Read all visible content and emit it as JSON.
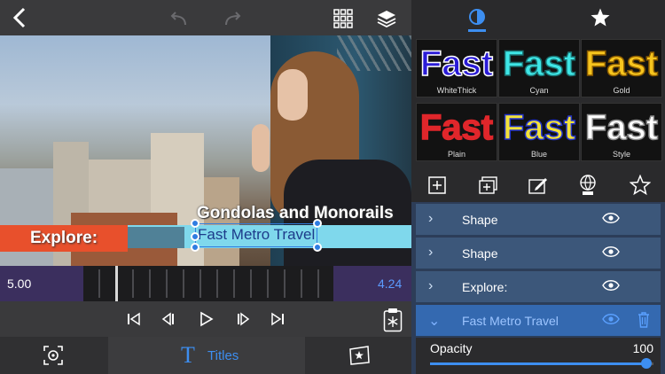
{
  "styles": [
    {
      "word": "Fast",
      "label": "WhiteThick",
      "fill": "#2a1bd6",
      "stroke": "#ffffff"
    },
    {
      "word": "Fast",
      "label": "Cyan",
      "fill": "#3ee6e6",
      "stroke": "#1a6f6f"
    },
    {
      "word": "Fast",
      "label": "Gold",
      "fill": "#f7c51e",
      "stroke": "#8a5b00"
    },
    {
      "word": "Fast",
      "label": "Plain",
      "fill": "#e0262b",
      "stroke": "#e0262b"
    },
    {
      "word": "Fast",
      "label": "Blue",
      "fill": "#f3e23a",
      "stroke": "#2233cc"
    },
    {
      "word": "Fast",
      "label": "Style",
      "fill": "#ffffff",
      "stroke": "#888888"
    }
  ],
  "overlay": {
    "heading": "Gondolas and Monorails",
    "subheading": "Fast Metro Travel",
    "tag": "Explore:"
  },
  "timeline": {
    "start": "5.00",
    "end": "4.24"
  },
  "bottom_tab": {
    "label": "Titles",
    "icon_glyph": "T"
  },
  "layers": [
    {
      "label": "Shape",
      "expanded": false
    },
    {
      "label": "Shape",
      "expanded": false
    },
    {
      "label": "Explore:",
      "expanded": false
    },
    {
      "label": "Fast Metro Travel",
      "expanded": true
    }
  ],
  "opacity": {
    "label": "Opacity",
    "value": "100",
    "fraction": 0.97
  },
  "colors": {
    "accent": "#3d8ef0",
    "tag_red": "#e8502c",
    "banner_cyan": "#7fd8ec"
  }
}
